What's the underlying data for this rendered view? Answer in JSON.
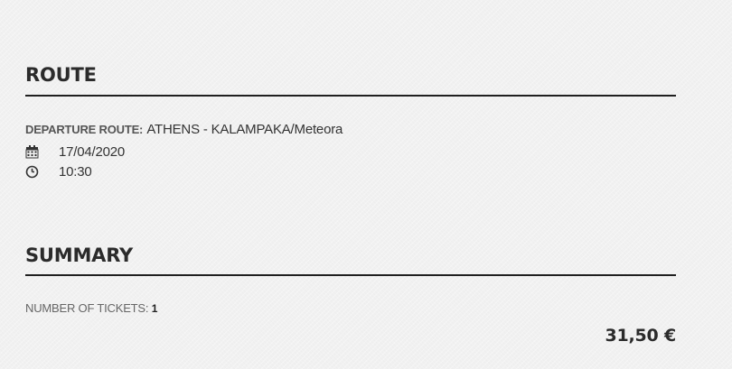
{
  "route": {
    "title": "ROUTE",
    "departure_label": "DEPARTURE ROUTE:",
    "departure_value": "ATHENS - KALAMPAKA/Meteora",
    "date": "17/04/2020",
    "time": "10:30",
    "date_icon": "calendar-icon",
    "time_icon": "clock-icon"
  },
  "summary": {
    "title": "SUMMARY",
    "tickets_label": "NUMBER OF TICKETS:",
    "tickets_count": "1",
    "total": "31,50 €"
  }
}
